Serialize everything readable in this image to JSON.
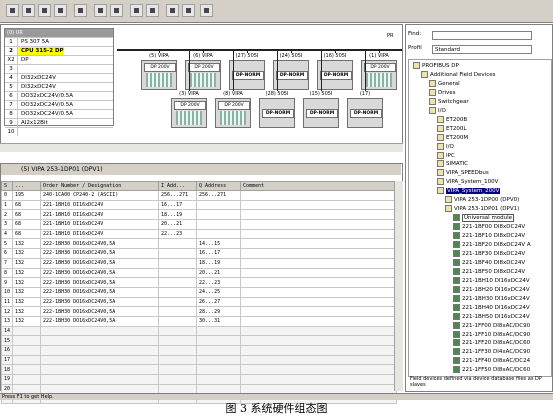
{
  "watermark": "ENGINEERING",
  "hw_config": {
    "rack_title": "(0) UR",
    "rack_rows": [
      {
        "slot": "1",
        "module": "PS 307 5A",
        "bold": false,
        "sel": false
      },
      {
        "slot": "2",
        "module": "CPU 315-2 DP",
        "bold": true,
        "sel": true
      },
      {
        "slot": "X2",
        "module": "DP",
        "bold": false,
        "sel": false
      },
      {
        "slot": "3",
        "module": "",
        "bold": false,
        "sel": false
      },
      {
        "slot": "4",
        "module": "DI32xDC24V",
        "bold": false,
        "sel": false
      },
      {
        "slot": "5",
        "module": "DI32xDC24V",
        "bold": false,
        "sel": false
      },
      {
        "slot": "6",
        "module": "DO32xDC24V/0.5A",
        "bold": false,
        "sel": false
      },
      {
        "slot": "7",
        "module": "DO32xDC24V/0.5A",
        "bold": false,
        "sel": false
      },
      {
        "slot": "8",
        "module": "DO32xDC24V/0.5A",
        "bold": false,
        "sel": false
      },
      {
        "slot": "9",
        "module": "AI2x12Bit",
        "bold": false,
        "sel": false
      },
      {
        "slot": "10",
        "module": "",
        "bold": false,
        "sel": false
      }
    ],
    "bus_label": "PR",
    "slaves_row1": [
      {
        "label": "(5) VIPA",
        "tag": "DP 200V",
        "norm": false
      },
      {
        "label": "(6) VIPA",
        "tag": "DP 200V",
        "norm": false
      },
      {
        "label": "(27) 505I",
        "tag": "DP-NORM",
        "norm": true
      },
      {
        "label": "(24) 505I",
        "tag": "DP-NORM",
        "norm": true
      },
      {
        "label": "(16) 505I",
        "tag": "DP-NORM",
        "norm": true
      },
      {
        "label": "(1) VIPA",
        "tag": "DP 200V",
        "norm": false
      }
    ],
    "slaves_row2": [
      {
        "label": "(3) VIPA",
        "tag": "DP 200V",
        "norm": false
      },
      {
        "label": "(8) VIPA",
        "tag": "DP 200V",
        "norm": false
      },
      {
        "label": "(28) 505I",
        "tag": "DP-NORM",
        "norm": true
      },
      {
        "label": "(15) 505I",
        "tag": "DP-NORM",
        "norm": true
      },
      {
        "label": "(17)",
        "tag": "DP-NORM",
        "norm": true
      }
    ]
  },
  "detail": {
    "header": "(5)   VIPA 253-1DP01 (DPV1)",
    "columns": [
      "S",
      "...",
      "Order Number / Designation",
      "I Add...",
      "Q Address",
      "Comment"
    ],
    "rows": [
      [
        "0",
        "195",
        "240-1CA00 CP240-2 (ASCII)",
        "256...271",
        "256...271",
        ""
      ],
      [
        "1",
        "68",
        "221-1BH10 DI16xDC24V",
        "16...17",
        "",
        ""
      ],
      [
        "2",
        "68",
        "221-1BH10 DI16xDC24V",
        "18...19",
        "",
        ""
      ],
      [
        "3",
        "68",
        "221-1BH10 DI16xDC24V",
        "20...21",
        "",
        ""
      ],
      [
        "4",
        "68",
        "221-1BH10 DI16xDC24V",
        "22...23",
        "",
        ""
      ],
      [
        "5",
        "132",
        "222-1BH30 DO16xDC24V0,5A",
        "",
        "14...15",
        ""
      ],
      [
        "6",
        "132",
        "222-1BH30 DO16xDC24V0,5A",
        "",
        "16...17",
        ""
      ],
      [
        "7",
        "132",
        "222-1BH30 DO16xDC24V0,5A",
        "",
        "18...19",
        ""
      ],
      [
        "8",
        "132",
        "222-1BH30 DO16xDC24V0,5A",
        "",
        "20...21",
        ""
      ],
      [
        "9",
        "132",
        "222-1BH30 DO16xDC24V0,5A",
        "",
        "22...23",
        ""
      ],
      [
        "10",
        "132",
        "222-1BH30 DO16xDC24V0,5A",
        "",
        "24...25",
        ""
      ],
      [
        "11",
        "132",
        "222-1BH30 DO16xDC24V0,5A",
        "",
        "26...27",
        ""
      ],
      [
        "12",
        "132",
        "222-1BH30 DO16xDC24V0,5A",
        "",
        "28...29",
        ""
      ],
      [
        "13",
        "132",
        "222-1BH30 DO16xDC24V0,5A",
        "",
        "30...31",
        ""
      ],
      [
        "14",
        "",
        "",
        "",
        "",
        ""
      ],
      [
        "15",
        "",
        "",
        "",
        "",
        ""
      ],
      [
        "16",
        "",
        "",
        "",
        "",
        ""
      ],
      [
        "17",
        "",
        "",
        "",
        "",
        ""
      ],
      [
        "18",
        "",
        "",
        "",
        "",
        ""
      ],
      [
        "19",
        "",
        "",
        "",
        "",
        ""
      ],
      [
        "20",
        "",
        "",
        "",
        "",
        ""
      ],
      [
        "21",
        "",
        "",
        "",
        "",
        ""
      ]
    ]
  },
  "catalog": {
    "find_label": "Find:",
    "profil_label": "Profil",
    "profil_value": "Standard",
    "tree": [
      {
        "t": "PROFIBUS DP",
        "lvl": 0,
        "green": false
      },
      {
        "t": "Additional Field Devices",
        "lvl": 1,
        "green": false
      },
      {
        "t": "General",
        "lvl": 2,
        "green": false
      },
      {
        "t": "Drives",
        "lvl": 2,
        "green": false
      },
      {
        "t": "Switchgear",
        "lvl": 2,
        "green": false
      },
      {
        "t": "I/O",
        "lvl": 2,
        "green": false
      },
      {
        "t": "ET200B",
        "lvl": 3,
        "green": false
      },
      {
        "t": "ET200L",
        "lvl": 3,
        "green": false
      },
      {
        "t": "ET200M",
        "lvl": 3,
        "green": false
      },
      {
        "t": "I/O",
        "lvl": 3,
        "green": false
      },
      {
        "t": "IPC",
        "lvl": 3,
        "green": false
      },
      {
        "t": "SIMATIC",
        "lvl": 3,
        "green": false
      },
      {
        "t": "VIPA_SPEEDbus",
        "lvl": 3,
        "green": false
      },
      {
        "t": "VIPA_System_100V",
        "lvl": 3,
        "green": false
      },
      {
        "t": "VIPA_System_200V",
        "lvl": 3,
        "green": false,
        "sel": true
      },
      {
        "t": "VIPA 253-1DP00 (DPV0)",
        "lvl": 4,
        "green": false
      },
      {
        "t": "VIPA 253-1DP01 (DPV1)",
        "lvl": 4,
        "green": false
      },
      {
        "t": "Universal module",
        "lvl": 5,
        "green": true,
        "box": true
      },
      {
        "t": "221-1BF00 DI8xDC24V",
        "lvl": 5,
        "green": true
      },
      {
        "t": "221-1BF10 DI8xDC24V",
        "lvl": 5,
        "green": true
      },
      {
        "t": "221-1BF20 DI8xDC24V A",
        "lvl": 5,
        "green": true
      },
      {
        "t": "221-1BF30 DI8xDC24V",
        "lvl": 5,
        "green": true
      },
      {
        "t": "221-1BF40 DI8xDC24V",
        "lvl": 5,
        "green": true
      },
      {
        "t": "221-1BF50 DI8xDC24V",
        "lvl": 5,
        "green": true
      },
      {
        "t": "221-1BH10 DI16xDC24V",
        "lvl": 5,
        "green": true
      },
      {
        "t": "221-1BH20 DI16xDC24V",
        "lvl": 5,
        "green": true
      },
      {
        "t": "221-1BH30 DI16xDC24V",
        "lvl": 5,
        "green": true
      },
      {
        "t": "221-1BH40 DI16xDC24V",
        "lvl": 5,
        "green": true
      },
      {
        "t": "221-1BH50 DI16xDC24V",
        "lvl": 5,
        "green": true
      },
      {
        "t": "221-1FF00 DI8xAC/DC90",
        "lvl": 5,
        "green": true
      },
      {
        "t": "221-1FF10 DI8xAC/DC90",
        "lvl": 5,
        "green": true
      },
      {
        "t": "221-1FF20 DI8xAC/DC60",
        "lvl": 5,
        "green": true
      },
      {
        "t": "221-1FF30 DI4xAC/DC90",
        "lvl": 5,
        "green": true
      },
      {
        "t": "221-1FF40 DI8xAC/DC24",
        "lvl": 5,
        "green": true
      },
      {
        "t": "221-1FF50 DI8xAC/DC60",
        "lvl": 5,
        "green": true
      }
    ],
    "info": "Field devices defined via device database files as DP slaves"
  },
  "status": "Press F1 to get Help.",
  "caption": "图 3   系统硬件组态图"
}
